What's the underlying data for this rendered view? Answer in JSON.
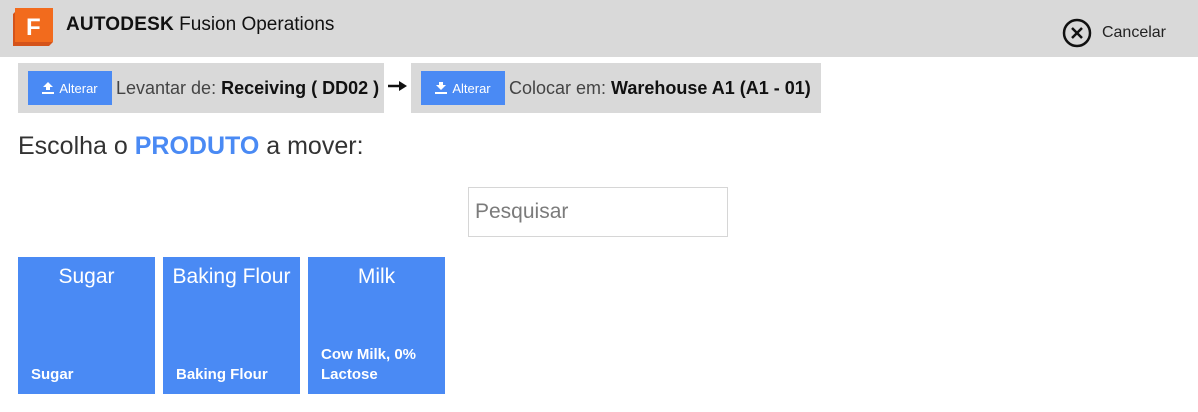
{
  "header": {
    "brand_bold": "AUTODESK",
    "brand_rest": " Fusion Operations",
    "logo_letter": "F",
    "cancel_label": "Cancelar",
    "icons": {
      "logo": "fusion-logo-icon",
      "cancel": "close-circle-icon"
    }
  },
  "pick": {
    "button_label": "Alterar",
    "label": "Levantar de:",
    "value": "Receiving ( DD02 )",
    "icon": "upload-icon"
  },
  "place": {
    "button_label": "Alterar",
    "label": "Colocar em:",
    "value": "Warehouse A1 (A1 - 01)",
    "icon": "download-icon"
  },
  "prompt": {
    "before": "Escolha o ",
    "highlight": "PRODUTO",
    "after": " a mover:"
  },
  "search": {
    "placeholder": "Pesquisar",
    "value": ""
  },
  "products": [
    {
      "title": "Sugar",
      "subtitle": "Sugar"
    },
    {
      "title": "Baking Flour",
      "subtitle": "Baking Flour"
    },
    {
      "title": "Milk",
      "subtitle": "Cow Milk, 0% Lactose"
    }
  ],
  "colors": {
    "accent": "#4a8af4",
    "bar_bg": "#d9d9d9",
    "logo_orange": "#f26b1d"
  }
}
